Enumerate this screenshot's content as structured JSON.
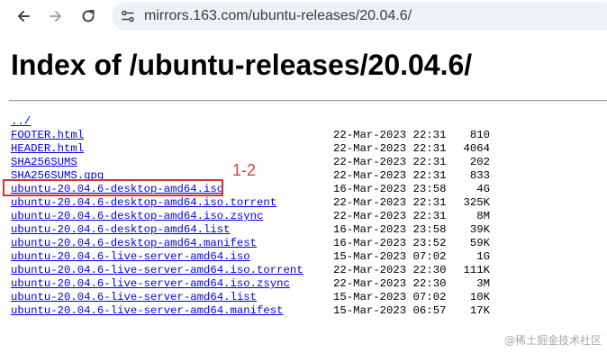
{
  "browser": {
    "url": "mirrors.163.com/ubuntu-releases/20.04.6/"
  },
  "page": {
    "heading": "Index of /ubuntu-releases/20.04.6/",
    "parent_link": "../",
    "entries": [
      {
        "name": "FOOTER.html",
        "date": "22-Mar-2023 22:31",
        "size": "810"
      },
      {
        "name": "HEADER.html",
        "date": "22-Mar-2023 22:31",
        "size": "4064"
      },
      {
        "name": "SHA256SUMS",
        "date": "22-Mar-2023 22:31",
        "size": "202"
      },
      {
        "name": "SHA256SUMS.gpg",
        "date": "22-Mar-2023 22:31",
        "size": "833"
      },
      {
        "name": "ubuntu-20.04.6-desktop-amd64.iso",
        "date": "16-Mar-2023 23:58",
        "size": "4G"
      },
      {
        "name": "ubuntu-20.04.6-desktop-amd64.iso.torrent",
        "date": "22-Mar-2023 22:31",
        "size": "325K"
      },
      {
        "name": "ubuntu-20.04.6-desktop-amd64.iso.zsync",
        "date": "22-Mar-2023 22:31",
        "size": "8M"
      },
      {
        "name": "ubuntu-20.04.6-desktop-amd64.list",
        "date": "16-Mar-2023 23:58",
        "size": "39K"
      },
      {
        "name": "ubuntu-20.04.6-desktop-amd64.manifest",
        "date": "16-Mar-2023 23:52",
        "size": "59K"
      },
      {
        "name": "ubuntu-20.04.6-live-server-amd64.iso",
        "date": "15-Mar-2023 07:02",
        "size": "1G"
      },
      {
        "name": "ubuntu-20.04.6-live-server-amd64.iso.torrent",
        "date": "22-Mar-2023 22:30",
        "size": "111K"
      },
      {
        "name": "ubuntu-20.04.6-live-server-amd64.iso.zsync",
        "date": "22-Mar-2023 22:30",
        "size": "3M"
      },
      {
        "name": "ubuntu-20.04.6-live-server-amd64.list",
        "date": "15-Mar-2023 07:02",
        "size": "10K"
      },
      {
        "name": "ubuntu-20.04.6-live-server-amd64.manifest",
        "date": "15-Mar-2023 06:57",
        "size": "17K"
      }
    ]
  },
  "annotation": {
    "label": "1-2",
    "color": "#d93030"
  },
  "watermark": "@稀土掘金技术社区",
  "icons": {
    "back": "arrow-left-icon",
    "forward": "arrow-right-icon",
    "reload": "reload-icon",
    "site_info": "site-settings-icon"
  }
}
